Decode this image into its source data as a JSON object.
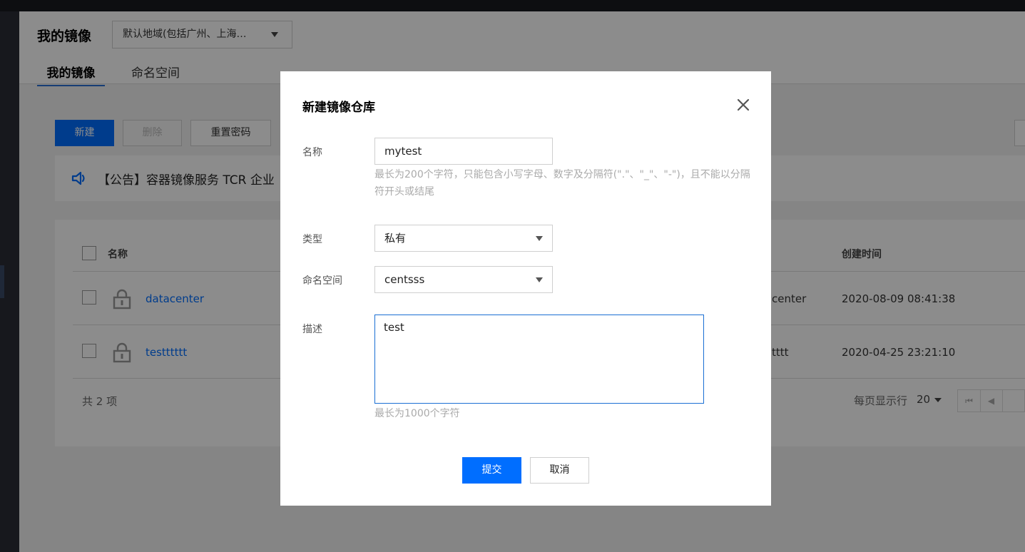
{
  "header": {
    "title": "我的镜像",
    "region_select": "默认地域(包括广州、上海…",
    "tabs": [
      "我的镜像",
      "命名空间"
    ]
  },
  "toolbar": {
    "new_label": "新建",
    "delete_label": "删除",
    "reset_password_label": "重置密码"
  },
  "notice": {
    "text": "【公告】容器镜像服务 TCR 企业"
  },
  "table": {
    "columns": {
      "name": "名称",
      "created": "创建时间"
    },
    "rows": [
      {
        "name": "datacenter",
        "namespace_partial": "center",
        "created": "2020-08-09 08:41:38"
      },
      {
        "name": "testttttt",
        "namespace_partial": "tttt",
        "created": "2020-04-25 23:21:10"
      }
    ],
    "footer": {
      "total": "共 2 项",
      "per_page_label": "每页显示行",
      "per_page_value": "20"
    }
  },
  "modal": {
    "title": "新建镜像仓库",
    "name": {
      "label": "名称",
      "value": "mytest",
      "hint": "最长为200个字符，只能包含小写字母、数字及分隔符(\".\"、\"_\"、\"-\")，且不能以分隔符开头或结尾"
    },
    "type": {
      "label": "类型",
      "value": "私有"
    },
    "namespace": {
      "label": "命名空间",
      "value": "centsss"
    },
    "description": {
      "label": "描述",
      "value": "test",
      "hint": "最长为1000个字符"
    },
    "submit_label": "提交",
    "cancel_label": "取消"
  },
  "colors": {
    "primary": "#006eff",
    "link": "#006eff",
    "focus_border": "#1a6fd4"
  }
}
